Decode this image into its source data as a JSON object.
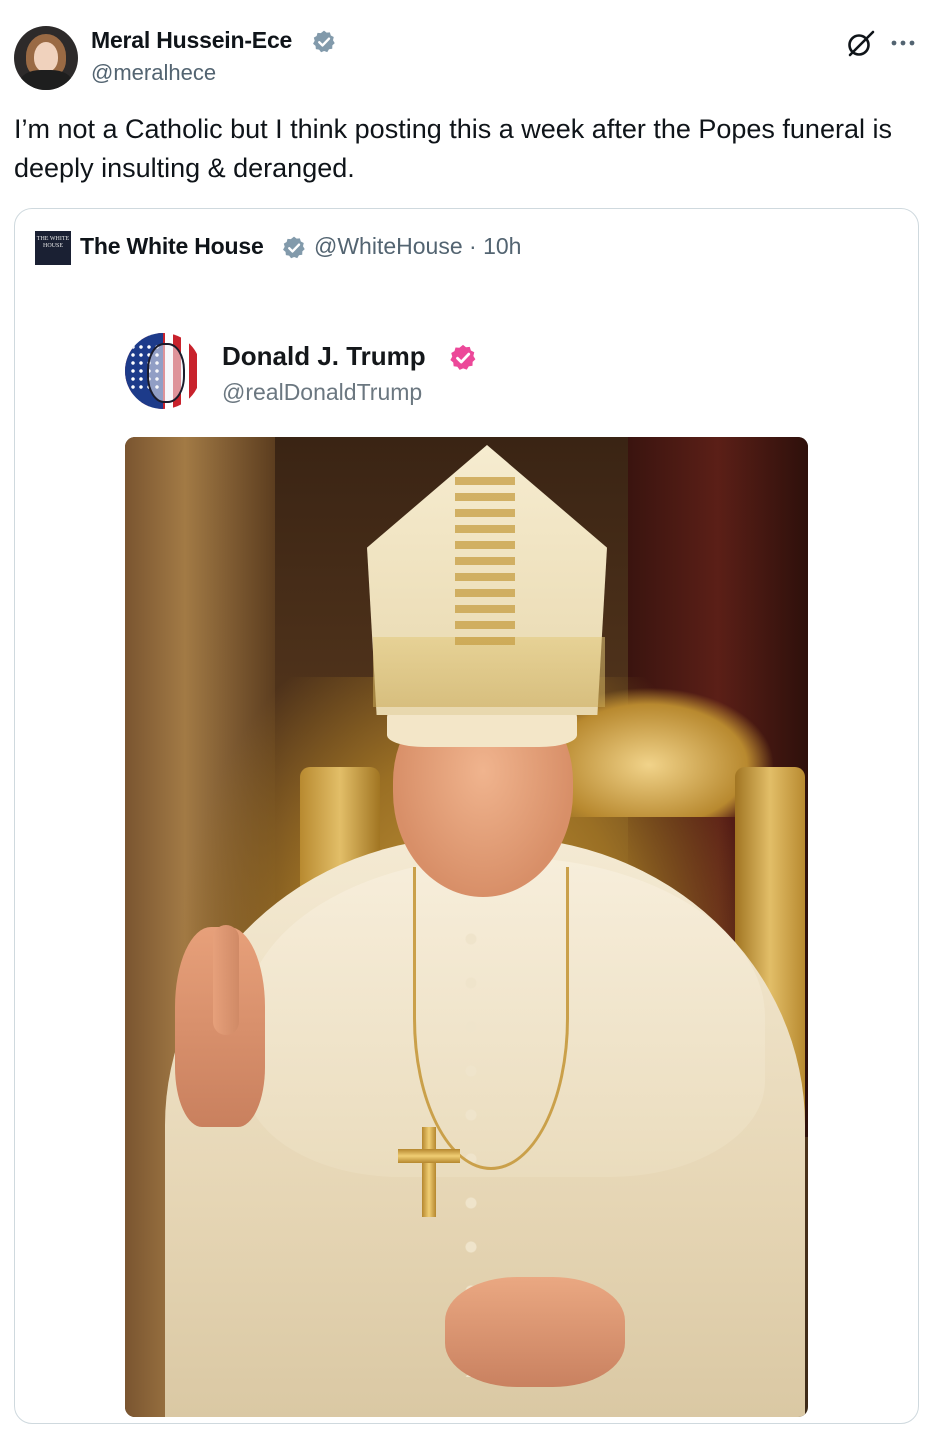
{
  "tweet": {
    "author": {
      "name": "Meral Hussein-Ece",
      "handle": "@meralhece",
      "verified": true
    },
    "text": "I’m not a Catholic but I think posting this a week after the Popes funeral is deeply insulting & deranged.",
    "icons": {
      "grok": "grok-icon",
      "more": "more-options-icon"
    }
  },
  "quote": {
    "author": {
      "name": "The White House",
      "logo_text": "THE WHITE HOUSE",
      "verified": true
    },
    "meta": "@WhiteHouse · 10h",
    "embedded_post": {
      "name": "Donald J. Trump",
      "handle": "@realDonaldTrump",
      "verified": true
    }
  },
  "colors": {
    "text_primary": "#0f1419",
    "text_secondary": "#536471",
    "border": "#cfd9de",
    "verified_gray": "#829aab",
    "verified_pink": "#ec4899"
  }
}
